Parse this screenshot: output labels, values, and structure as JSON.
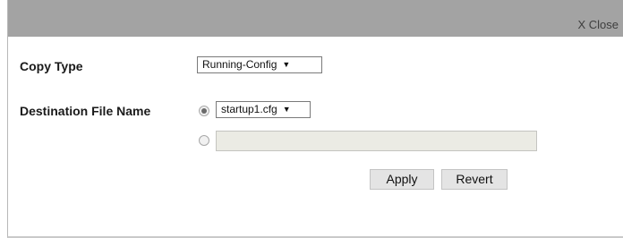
{
  "dialog": {
    "close_label": "X Close"
  },
  "form": {
    "copy_type": {
      "label": "Copy Type",
      "selected": "Running-Config"
    },
    "destination": {
      "label": "Destination File Name",
      "file_select_selected": "startup1.cfg",
      "custom_name_value": ""
    }
  },
  "buttons": {
    "apply": "Apply",
    "revert": "Revert"
  }
}
